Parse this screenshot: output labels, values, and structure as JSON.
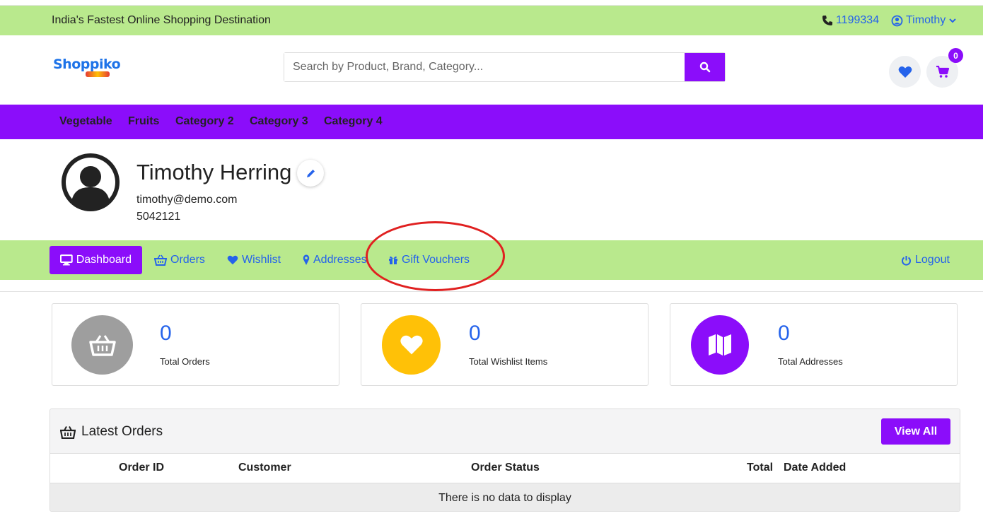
{
  "topbar": {
    "tagline": "India's Fastest Online Shopping Destination",
    "phone": "1199334",
    "user": "Timothy"
  },
  "header": {
    "logo_text": "Shoppiko",
    "search_placeholder": "Search by Product, Brand, Category...",
    "cart_count": "0"
  },
  "categories": [
    "Vegetable",
    "Fruits",
    "Category 2",
    "Category 3",
    "Category 4"
  ],
  "profile": {
    "name": "Timothy Herring",
    "email": "timothy@demo.com",
    "phone": "5042121"
  },
  "account_nav": {
    "dashboard": "Dashboard",
    "orders": "Orders",
    "wishlist": "Wishlist",
    "addresses": "Addresses",
    "gift_vouchers": "Gift Vouchers",
    "logout": "Logout"
  },
  "stats": [
    {
      "value": "0",
      "label": "Total Orders",
      "color": "#9e9e9e",
      "icon": "basket-icon"
    },
    {
      "value": "0",
      "label": "Total Wishlist Items",
      "color": "#ffc107",
      "icon": "heart-icon"
    },
    {
      "value": "0",
      "label": "Total Addresses",
      "color": "#8b0dfa",
      "icon": "map-icon"
    }
  ],
  "latest_orders": {
    "title": "Latest Orders",
    "view_all": "View All",
    "columns": [
      "Order ID",
      "Customer",
      "Order Status",
      "Total",
      "Date Added"
    ],
    "empty_text": "There is no data to display"
  },
  "colors": {
    "accent": "#8b0dfa",
    "topbar": "#b9e98d",
    "link": "#2563eb",
    "annotation": "#e02020"
  }
}
